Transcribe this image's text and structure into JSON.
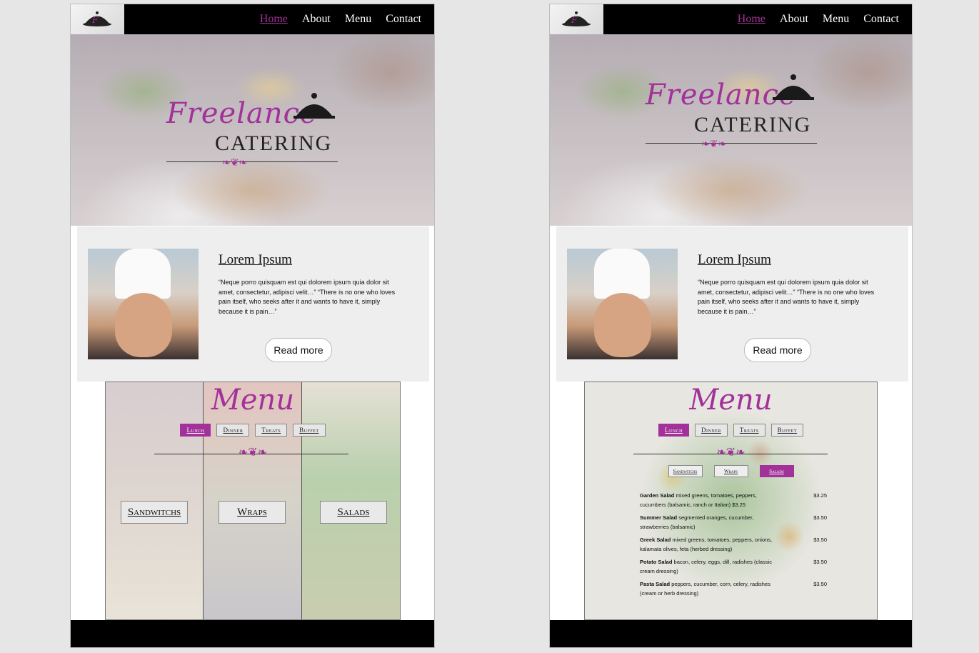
{
  "nav": {
    "links": [
      "Home",
      "About",
      "Menu",
      "Contact"
    ]
  },
  "hero": {
    "brand_script": "Freelance",
    "brand_caps": "CATERING"
  },
  "about": {
    "heading": "Lorem Ipsum",
    "text": "“Neque porro quisquam est qui dolorem ipsum quia dolor sit amet, consectetur, adipisci velit…” “There is no one who loves pain itself, who seeks after it and wants to have it, simply because it is pain…”",
    "button": "Read more"
  },
  "menu": {
    "title": "Menu",
    "tabs": [
      "Lunch",
      "Dinner",
      "Treats",
      "Buffet"
    ],
    "categories": [
      "Sandwitchs",
      "Wraps",
      "Salads"
    ],
    "subtabs": [
      "Sandwitchs",
      "Wraps",
      "Salads"
    ],
    "items": [
      {
        "name": "Garden Salad",
        "desc": "mixed greens, tomatoes, peppers, cucumbers (balsamic, ranch or Italian) $3.25",
        "price": "$3.25"
      },
      {
        "name": "Summer Salad",
        "desc": "segmented oranges, cucumber, strawberries (balsamic)",
        "price": "$3.50"
      },
      {
        "name": "Greek Salad",
        "desc": "mixed greens, tomatoes, peppers, onions, kalamata olives, feta (herbed dressing)",
        "price": "$3.50"
      },
      {
        "name": "Potato Salad",
        "desc": "bacon, celery, eggs, dill, radishes (classic cream dressing)",
        "price": "$3.50"
      },
      {
        "name": "Pasta Salad",
        "desc": "peppers, cucumber, corn, celery, radishes (cream or herb dressing)",
        "price": "$3.50"
      }
    ]
  },
  "colors": {
    "accent": "#a3319a",
    "header": "#000000"
  }
}
